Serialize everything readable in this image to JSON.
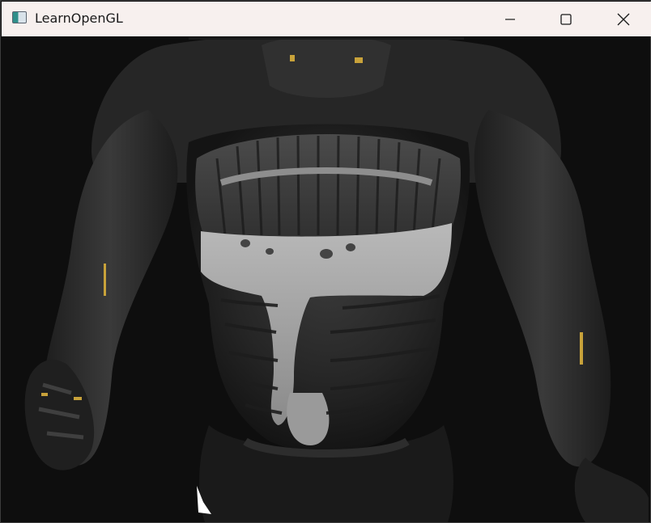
{
  "window": {
    "title": "LearnOpenGL",
    "controls": {
      "minimize_icon": "minimize-icon",
      "maximize_icon": "maximize-icon",
      "close_icon": "close-icon"
    }
  },
  "scene": {
    "description_icon": "nanosuit-model-render",
    "background_color": "#0e0e0e",
    "accent_color": "#c8a23a"
  }
}
